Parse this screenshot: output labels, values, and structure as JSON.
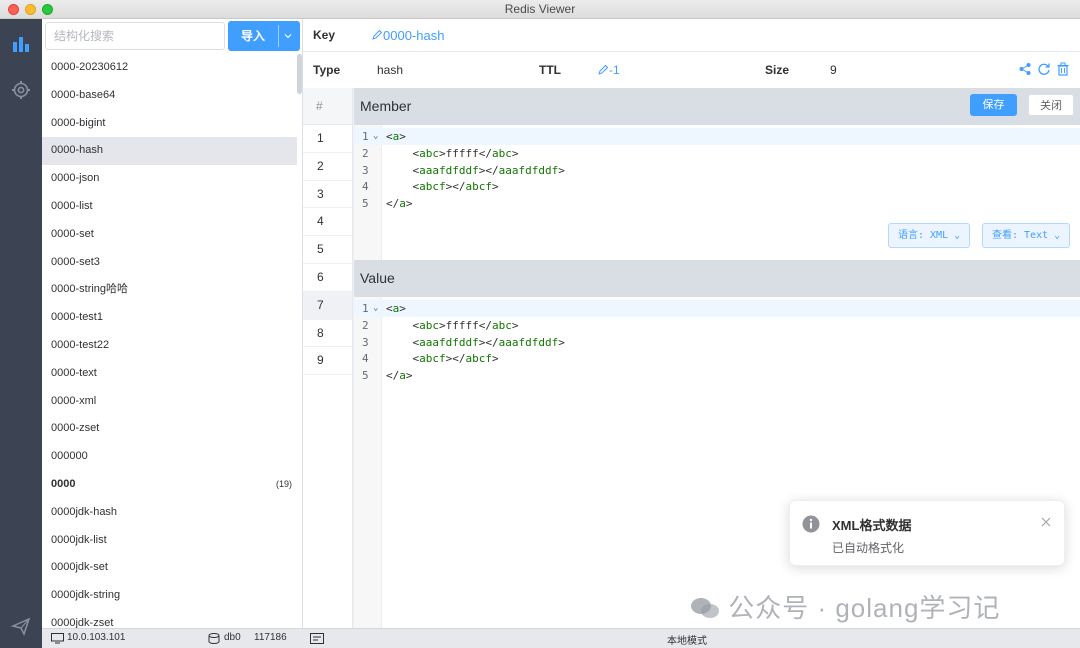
{
  "window": {
    "title": "Redis Viewer"
  },
  "rail": {
    "icons": [
      "bar-chart-icon",
      "gear-icon",
      "send-icon"
    ]
  },
  "search": {
    "placeholder": "结构化搜索",
    "value": ""
  },
  "import_button": {
    "label": "导入"
  },
  "keys": [
    {
      "name": "0000-20230612"
    },
    {
      "name": "0000-base64"
    },
    {
      "name": "0000-bigint"
    },
    {
      "name": "0000-hash",
      "selected": true
    },
    {
      "name": "0000-json"
    },
    {
      "name": "0000-list"
    },
    {
      "name": "0000-set"
    },
    {
      "name": "0000-set3"
    },
    {
      "name": "0000-string哈哈"
    },
    {
      "name": "0000-test1"
    },
    {
      "name": "0000-test22"
    },
    {
      "name": "0000-text"
    },
    {
      "name": "0000-xml"
    },
    {
      "name": "0000-zset"
    },
    {
      "name": "000000"
    },
    {
      "name": "0000",
      "folder": true,
      "count": "(19)"
    },
    {
      "name": "0000jdk-hash"
    },
    {
      "name": "0000jdk-list"
    },
    {
      "name": "0000jdk-set"
    },
    {
      "name": "0000jdk-string"
    },
    {
      "name": "0000jdk-zset"
    }
  ],
  "key_header": {
    "label": "Key",
    "value": "0000-hash"
  },
  "info": {
    "type_label": "Type",
    "type_value": "hash",
    "ttl_label": "TTL",
    "ttl_value": "-1",
    "size_label": "Size",
    "size_value": "9"
  },
  "index": {
    "header": "#",
    "rows": [
      "1",
      "2",
      "3",
      "4",
      "5",
      "6",
      "7",
      "8",
      "9"
    ],
    "selected_row": "7"
  },
  "member": {
    "title": "Member",
    "save_label": "保存",
    "close_label": "关闭",
    "lang_label": "语言: XML",
    "view_label": "查看: Text",
    "lines": [
      {
        "no": "1",
        "text": "<a>"
      },
      {
        "no": "2",
        "text": "    <abc>fffff</abc>"
      },
      {
        "no": "3",
        "text": "    <aaafdfddf></aaafdfddf>"
      },
      {
        "no": "4",
        "text": "    <abcf></abcf>"
      },
      {
        "no": "5",
        "text": "</a>"
      }
    ]
  },
  "value": {
    "title": "Value",
    "lines": [
      {
        "no": "1",
        "text": "<a>"
      },
      {
        "no": "2",
        "text": "    <abc>fffff</abc>"
      },
      {
        "no": "3",
        "text": "    <aaafdfddf></aaafdfddf>"
      },
      {
        "no": "4",
        "text": "    <abcf></abcf>"
      },
      {
        "no": "5",
        "text": "</a>"
      }
    ]
  },
  "toast": {
    "title": "XML格式数据",
    "message": "已自动格式化"
  },
  "watermark": {
    "text": "公众号 · golang学习记"
  },
  "status": {
    "host": "10.0.103.101",
    "db": "db0",
    "keys_count": "117186",
    "mode": "本地模式"
  },
  "colors": {
    "accent": "#409eff",
    "rail": "#3c4352",
    "section_header": "#d9dde4"
  }
}
